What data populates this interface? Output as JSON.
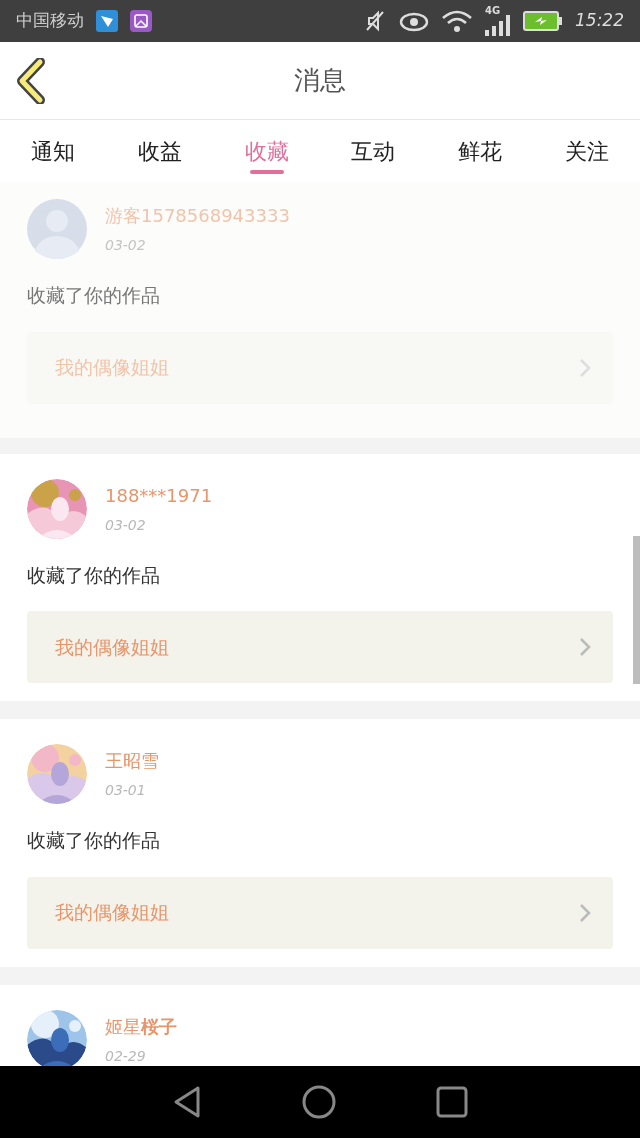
{
  "status_bar": {
    "carrier": "中国移动",
    "network": "4G",
    "time": "15:22"
  },
  "header": {
    "title": "消息"
  },
  "tabs": [
    {
      "label": "通知",
      "selected": false
    },
    {
      "label": "收益",
      "selected": false
    },
    {
      "label": "收藏",
      "selected": true
    },
    {
      "label": "互动",
      "selected": false
    },
    {
      "label": "鲜花",
      "selected": false
    },
    {
      "label": "关注",
      "selected": false
    }
  ],
  "messages": [
    {
      "avatar": {
        "kind": "default"
      },
      "name": "游客1578568943333",
      "date": "03-02",
      "text": "收藏了你的作品",
      "work": "我的偶像姐姐",
      "dimmed": true
    },
    {
      "name": "188***1971",
      "date": "03-02",
      "text": "收藏了你的作品",
      "work": "我的偶像姐姐",
      "dimmed": false
    },
    {
      "name": "王昭雪",
      "date": "03-01",
      "text": "收藏了你的作品",
      "work": "我的偶像姐姐",
      "dimmed": false
    },
    {
      "name": "姬星**桜子**",
      "date": "02-29",
      "dimmed": false
    }
  ]
}
